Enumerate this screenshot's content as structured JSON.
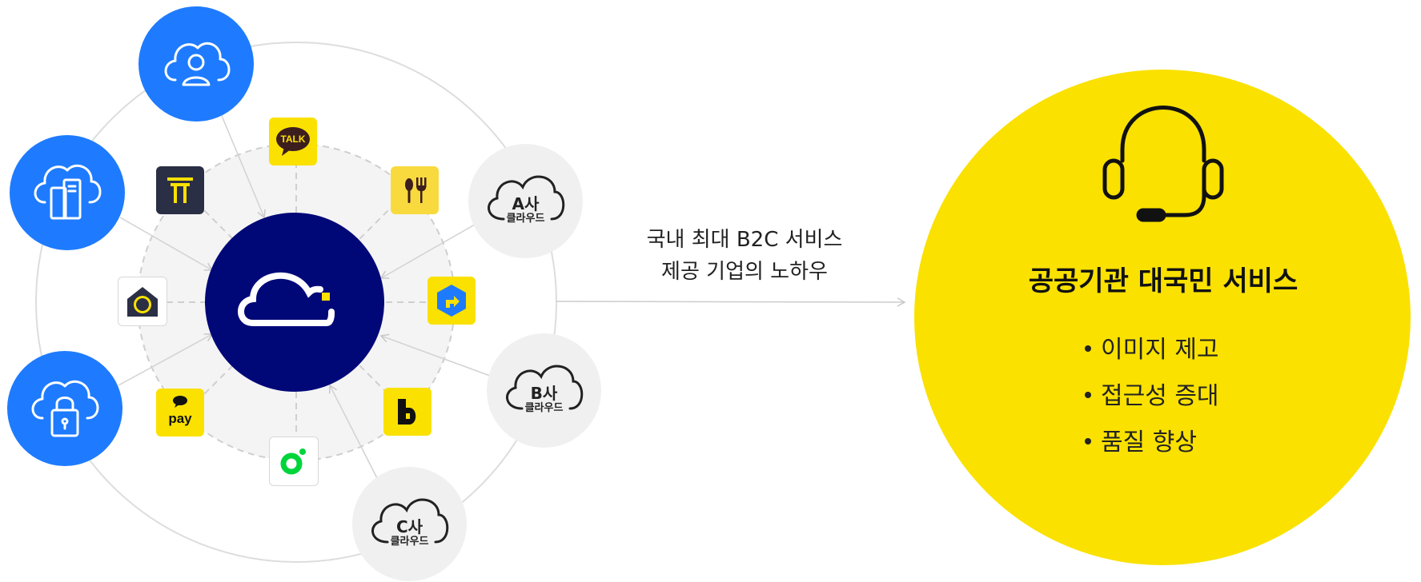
{
  "hub": {
    "icon": "cloud-icon"
  },
  "side_services": [
    {
      "icon": "cloud-user-icon"
    },
    {
      "icon": "cloud-server-icon"
    },
    {
      "icon": "cloud-lock-icon"
    }
  ],
  "apps": [
    {
      "name": "kakaotalk",
      "label": "TALK"
    },
    {
      "name": "kakao-t",
      "icon": "t-logo-icon"
    },
    {
      "name": "kakao-food",
      "icon": "spoon-fork-icon"
    },
    {
      "name": "kakao-home",
      "icon": "home-icon"
    },
    {
      "name": "kakao-navi",
      "icon": "navigation-arrow-icon"
    },
    {
      "name": "kakaopay",
      "label": "pay"
    },
    {
      "name": "kakao-bank-b",
      "icon": "b-logo-icon"
    },
    {
      "name": "kakao-green",
      "icon": "green-ring-icon"
    }
  ],
  "external_clouds": [
    {
      "company": "A사",
      "sub": "클라우드"
    },
    {
      "company": "B사",
      "sub": "클라우드"
    },
    {
      "company": "C사",
      "sub": "클라우드"
    }
  ],
  "arrow_caption": {
    "line1": "국내 최대 B2C 서비스",
    "line2": "제공 기업의 노하우"
  },
  "result": {
    "icon": "headset-icon",
    "title": "공공기관 대국민 서비스",
    "bullets": [
      "이미지 제고",
      "접근성 증대",
      "품질 향상"
    ]
  },
  "colors": {
    "hub_navy": "#000878",
    "service_blue": "#1E7BFF",
    "kakao_yellow": "#FAE100",
    "result_yellow": "#FAE100",
    "cloud_gray": "#F0F0F0"
  }
}
